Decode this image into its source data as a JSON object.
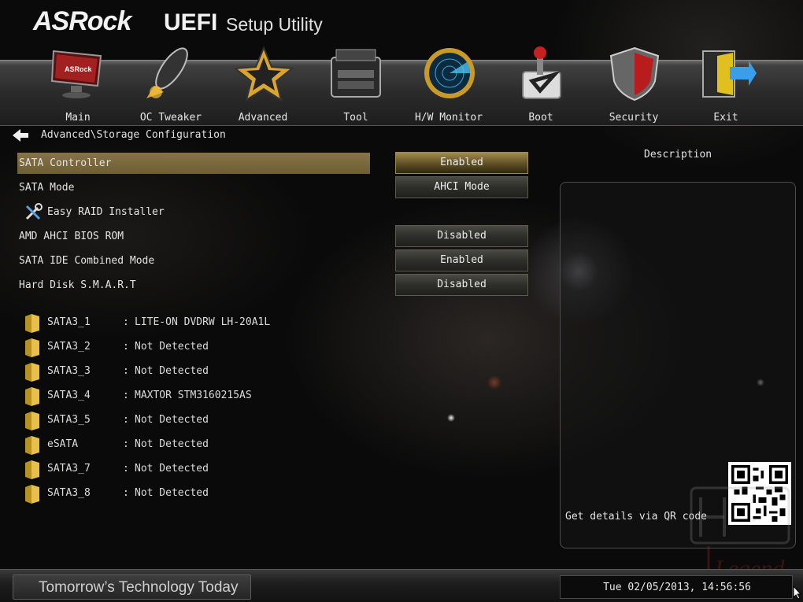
{
  "header": {
    "brand": "ASRock",
    "product": "UEFI",
    "subtitle": "Setup Utility"
  },
  "nav": {
    "items": [
      {
        "label": "Main",
        "icon": "monitor-icon"
      },
      {
        "label": "OC Tweaker",
        "icon": "rocket-icon"
      },
      {
        "label": "Advanced",
        "icon": "star-icon"
      },
      {
        "label": "Tool",
        "icon": "toolbox-icon"
      },
      {
        "label": "H/W Monitor",
        "icon": "radar-icon"
      },
      {
        "label": "Boot",
        "icon": "joystick-icon"
      },
      {
        "label": "Security",
        "icon": "shield-icon"
      },
      {
        "label": "Exit",
        "icon": "exit-door-icon"
      }
    ],
    "active": "Advanced"
  },
  "breadcrumb": "Advanced\\Storage Configuration",
  "settings": [
    {
      "label": "SATA Controller",
      "value": "Enabled",
      "selected": true
    },
    {
      "label": "SATA Mode",
      "value": "AHCI Mode",
      "selected": false
    },
    {
      "label": "Easy RAID Installer",
      "value": null,
      "icon": "wrench-screwdriver-icon"
    },
    {
      "label": "AMD AHCI BIOS ROM",
      "value": "Disabled",
      "selected": false
    },
    {
      "label": "SATA IDE Combined Mode",
      "value": "Enabled",
      "selected": false
    },
    {
      "label": "Hard Disk S.M.A.R.T",
      "value": "Disabled",
      "selected": false
    }
  ],
  "drives": [
    {
      "port": "SATA3_1",
      "sep": ":",
      "device": "LITE-ON DVDRW LH-20A1L"
    },
    {
      "port": "SATA3_2",
      "sep": ":",
      "device": "Not Detected"
    },
    {
      "port": "SATA3_3",
      "sep": ":",
      "device": "Not Detected"
    },
    {
      "port": "SATA3_4",
      "sep": ":",
      "device": "MAXTOR STM3160215AS"
    },
    {
      "port": "SATA3_5",
      "sep": ":",
      "device": "Not Detected"
    },
    {
      "port": "eSATA",
      "sep": ":",
      "device": "Not Detected"
    },
    {
      "port": "SATA3_7",
      "sep": ":",
      "device": "Not Detected"
    },
    {
      "port": "SATA3_8",
      "sep": ":",
      "device": "Not Detected"
    }
  ],
  "description": {
    "title": "Description",
    "qr_text": "Get details via QR code"
  },
  "watermark": "Legend",
  "footer": {
    "slogan": "Tomorrow’s Technology Today",
    "datetime": "Tue 02/05/2013, 14:56:56"
  },
  "colors": {
    "selected_bg": "#877446",
    "accent_gold": "#c9a94a",
    "text": "#e4e4e4"
  }
}
